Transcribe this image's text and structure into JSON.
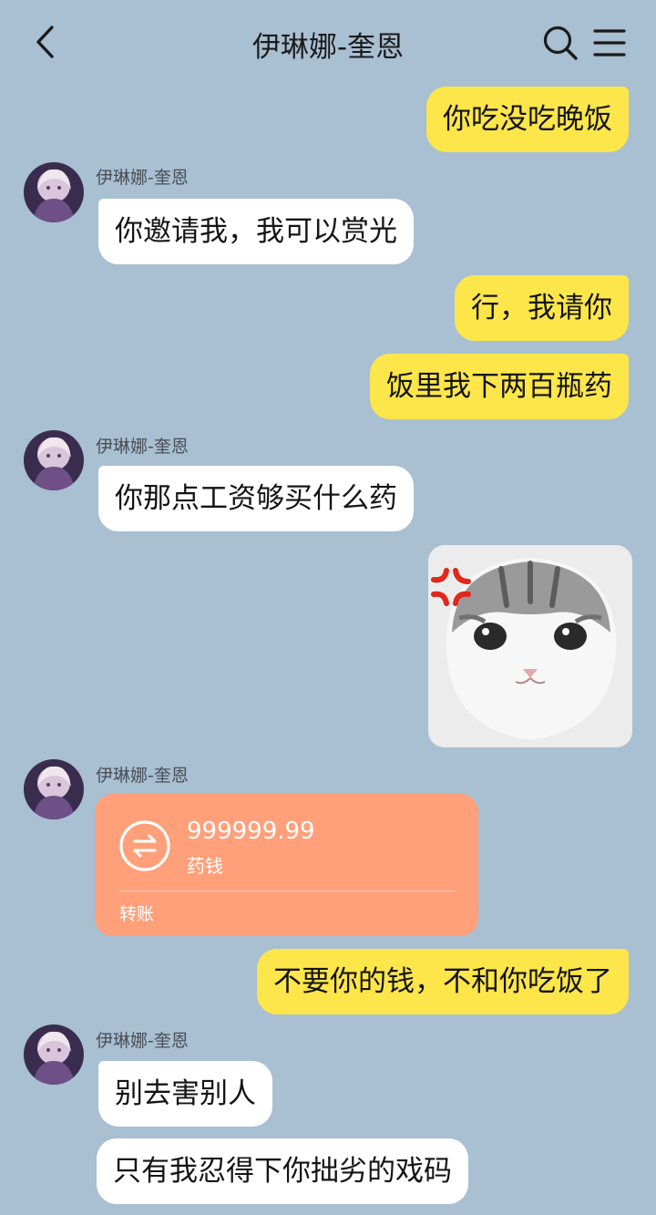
{
  "header": {
    "title": "伊琳娜-奎恩",
    "back_icon": "chevron-left-icon",
    "search_icon": "search-icon",
    "menu_icon": "menu-icon"
  },
  "contact": {
    "name": "伊琳娜-奎恩"
  },
  "messages": [
    {
      "from": "me",
      "text": "你吃没吃晚饭"
    },
    {
      "from": "them",
      "sender": "伊琳娜-奎恩",
      "text": "你邀请我，我可以赏光"
    },
    {
      "from": "me",
      "text": "行，我请你"
    },
    {
      "from": "me",
      "text": "饭里我下两百瓶药"
    },
    {
      "from": "them",
      "sender": "伊琳娜-奎恩",
      "text": "你那点工资够买什么药"
    },
    {
      "from": "me",
      "type": "sticker",
      "sticker": "angry-cat-sticker"
    },
    {
      "from": "them",
      "sender": "伊琳娜-奎恩",
      "type": "transfer",
      "amount": "999999.99",
      "note": "药钱",
      "label": "转账",
      "icon": "transfer-icon"
    },
    {
      "from": "me",
      "text": "不要你的钱，不和你吃饭了"
    },
    {
      "from": "them",
      "sender": "伊琳娜-奎恩",
      "text": "别去害别人"
    },
    {
      "from": "them",
      "text": "只有我忍得下你拙劣的戏码"
    }
  ],
  "colors": {
    "background": "#a9bfd2",
    "my_bubble": "#fce64a",
    "their_bubble": "#ffffff",
    "transfer_card": "#ffa07a"
  }
}
